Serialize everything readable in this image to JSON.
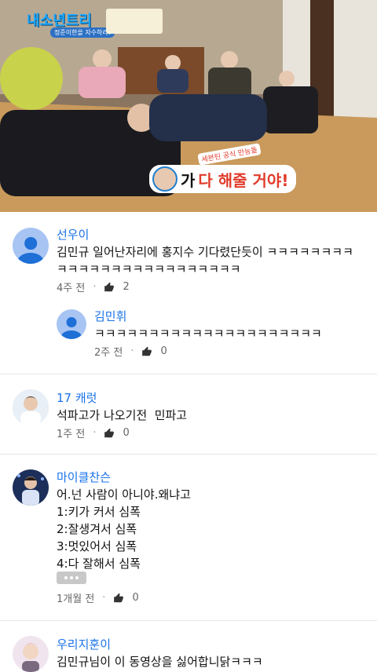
{
  "video": {
    "logo": "내소년트리",
    "logo_sub": "정준이한을 자수하라!",
    "caption_prefix": "가 ",
    "caption_highlight": "다 해줄 거야!",
    "caption_tag": "세븐틴 공식 만능돌"
  },
  "comments": [
    {
      "author": "선우이",
      "text": "김민규 일어난자리에 홍지수 기다렸단듯이 ㅋㅋㅋㅋㅋㅋㅋㅋ\nㅋㅋㅋㅋㅋㅋㅋㅋㅋㅋㅋㅋㅋㅋㅋㅋㅋ",
      "time": "4주 전",
      "likes": "2",
      "avatar": "default-user-icon",
      "reply": {
        "author": "김민휘",
        "text": "ㅋㅋㅋㅋㅋㅋㅋㅋㅋㅋㅋㅋㅋㅋㅋㅋㅋㅋㅋㅋㅋ",
        "time": "2주 전",
        "likes": "0",
        "avatar": "default-user-icon"
      }
    },
    {
      "author": "17 캐럿",
      "text": "석파고가 나오기전  민파고",
      "time": "1주 전",
      "likes": "0",
      "avatar": "profile-photo"
    },
    {
      "author": "마이클찬슨",
      "text": "어.넌 사람이 아니야.왜냐고\n1:키가 커서 심폭\n2:잘생겨서 심폭\n3:멋있어서 심폭\n4:다 잘해서 심폭",
      "time": "1개월 전",
      "likes": "0",
      "avatar": "profile-photo",
      "more": "more-options-icon"
    },
    {
      "author": "우리지훈이",
      "text": "김민규님이 이 동영상을 싫어합니닭ㅋㅋㅋ",
      "avatar": "profile-photo"
    }
  ],
  "colors": {
    "author": "#1a73e8",
    "divider": "#e5e5e5",
    "avatar_bg": "#a7c4f3",
    "avatar_fg": "#1e6fd6"
  }
}
